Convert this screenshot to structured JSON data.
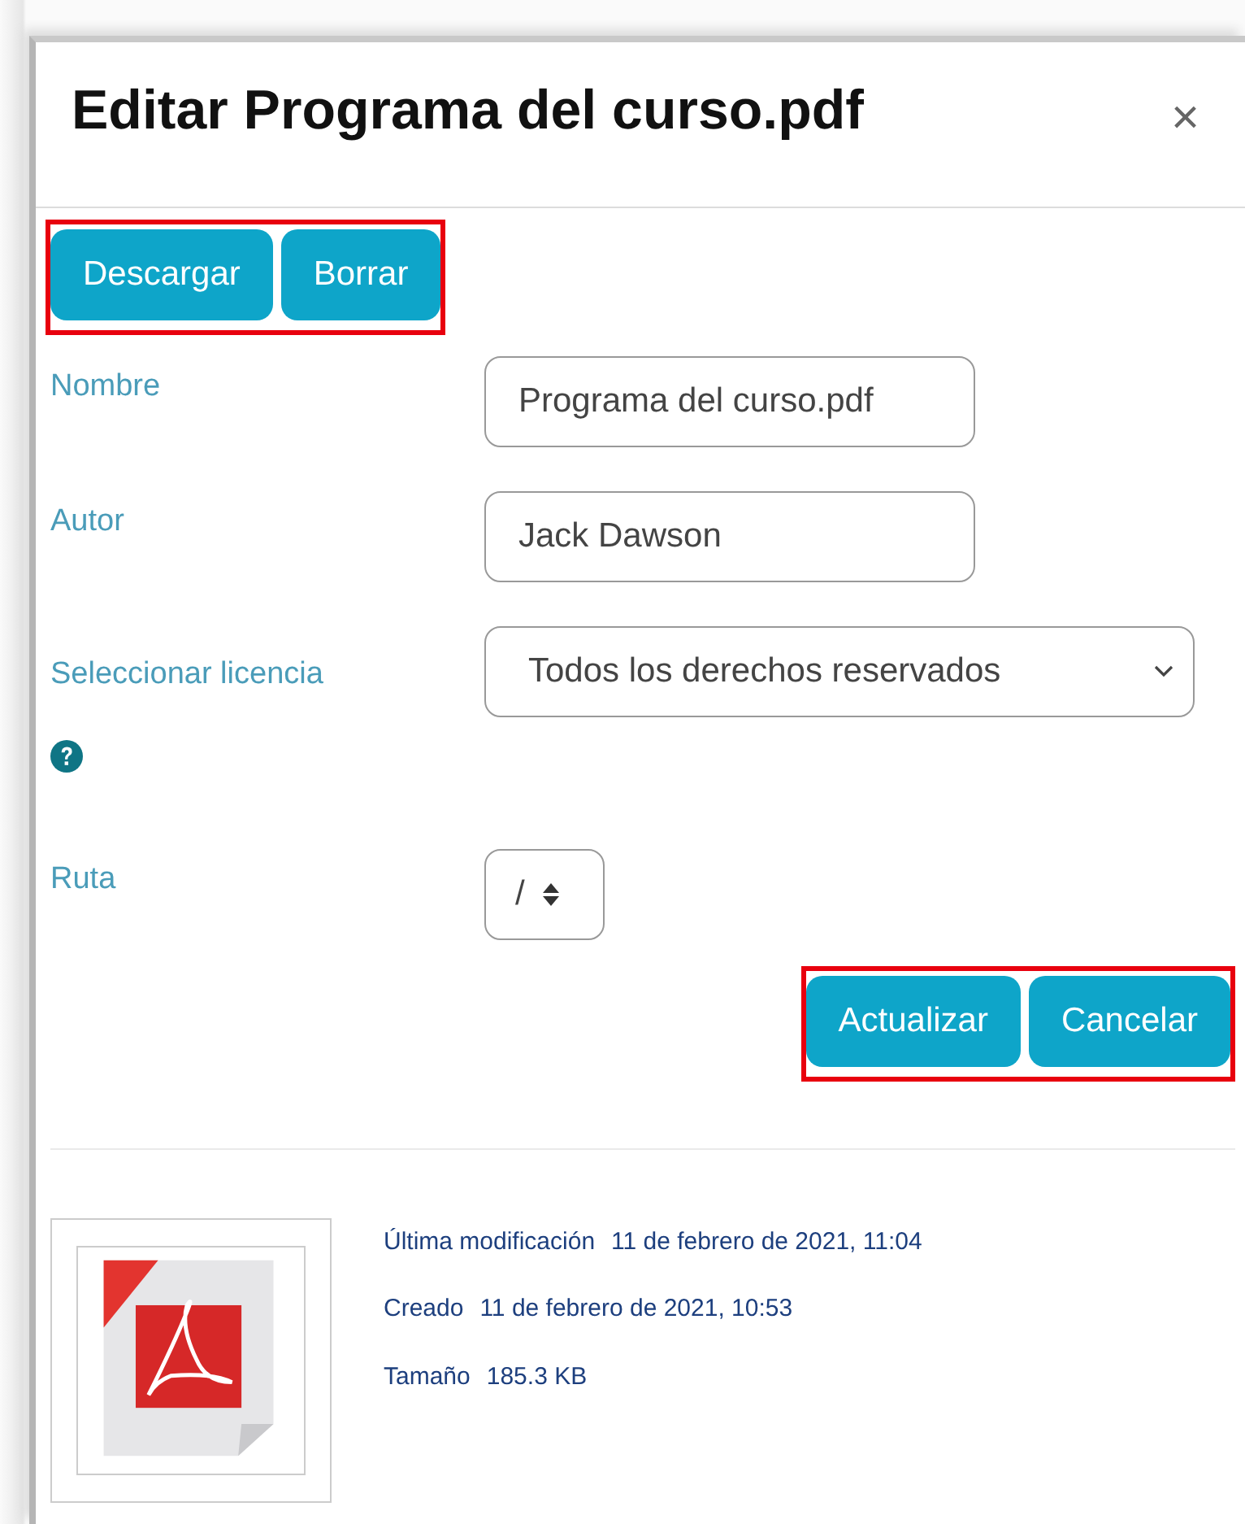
{
  "dialog": {
    "title": "Editar Programa del curso.pdf",
    "close": "×"
  },
  "top_buttons": {
    "highlighted": true,
    "buttons": [
      "Descargar",
      "Borrar"
    ]
  },
  "fields": [
    {
      "kind": "text",
      "label": "Nombre",
      "value": "Programa del curso.pdf"
    },
    {
      "kind": "text",
      "label": "Autor",
      "value": "Jack Dawson"
    },
    {
      "kind": "select",
      "label": "Seleccionar licencia",
      "value": "Todos los derechos reservados",
      "help": true
    },
    {
      "kind": "path",
      "label": "Ruta",
      "value": "/"
    }
  ],
  "bottom_buttons": {
    "highlighted": true,
    "buttons": [
      "Actualizar",
      "Cancelar"
    ]
  },
  "file_info": [
    {
      "label": "Última modificación",
      "value": "11 de febrero de 2021, 11:04"
    },
    {
      "label": "Creado",
      "value": "11 de febrero de 2021, 10:53"
    },
    {
      "label": "Tamaño",
      "value": "185.3 KB"
    }
  ]
}
